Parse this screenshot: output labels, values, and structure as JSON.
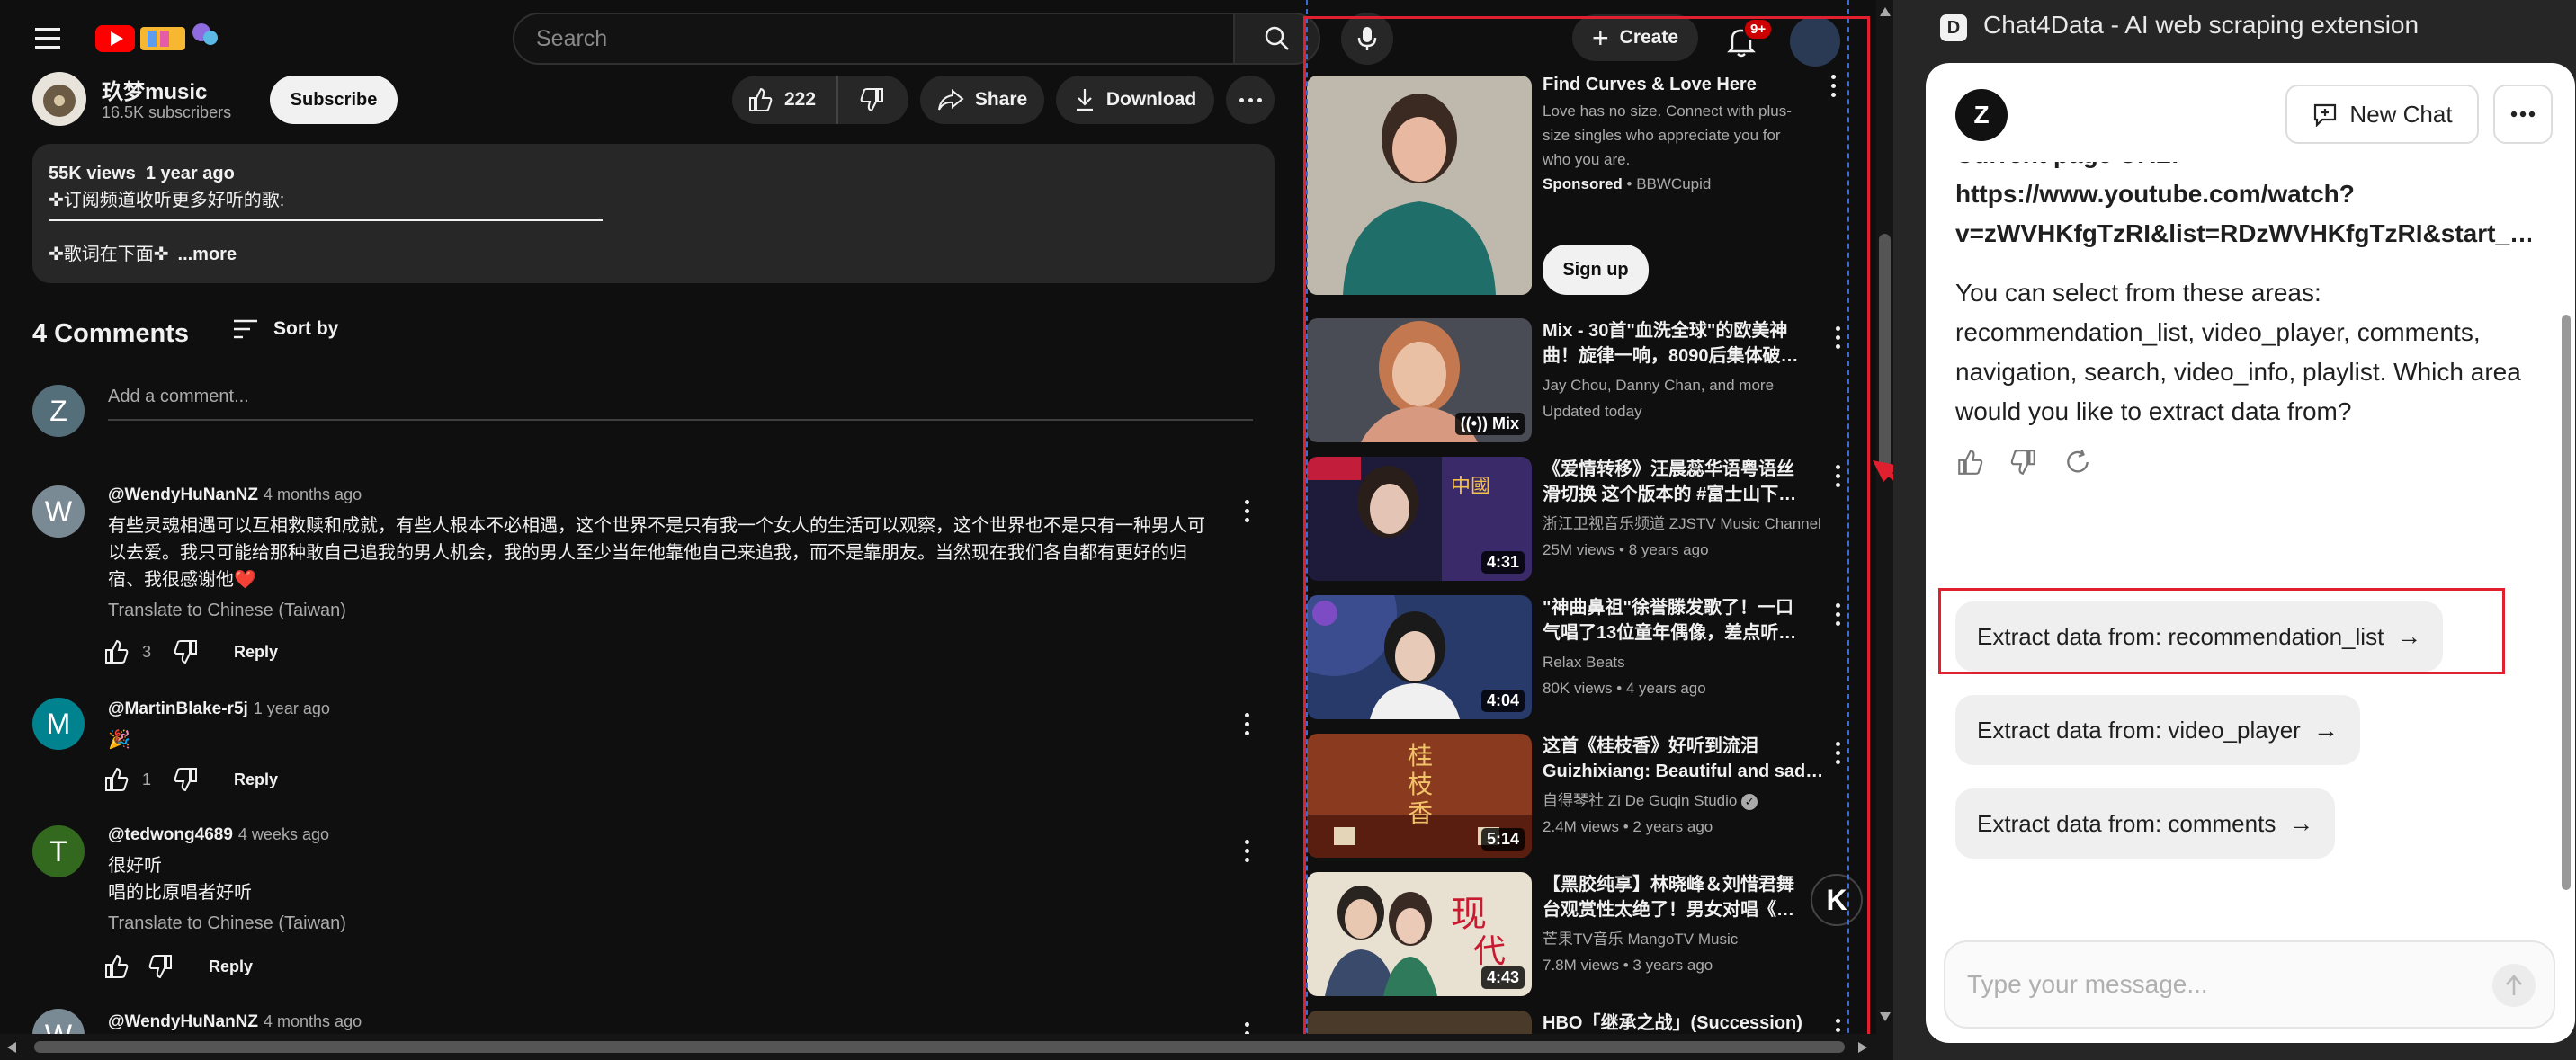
{
  "masthead": {
    "search_placeholder": "Search",
    "create_label": "Create",
    "notif_count": "9+"
  },
  "channel": {
    "name": "玖梦music",
    "subscribers": "16.5K subscribers",
    "subscribe_label": "Subscribe"
  },
  "actions": {
    "like_count": "222",
    "share_label": "Share",
    "download_label": "Download"
  },
  "description": {
    "stats": "55K views  1 year ago",
    "line1": "✜订阅频道收听更多好听的歌:",
    "line2": "✜歌词在下面✜",
    "more": "...more"
  },
  "comments_header": {
    "title": "4 Comments",
    "sort_label": "Sort by",
    "add_placeholder": "Add a comment...",
    "my_avatar": "Z"
  },
  "comments": [
    {
      "avatar": "W",
      "avatar_color": "#7a8a94",
      "author": "@WendyHuNanNZ",
      "time": "4 months ago",
      "text": "有些灵魂相遇可以互相救赎和成就，有些人根本不必相遇，这个世界不是只有我一个女人的生活可以观察，这个世界也不是只有一种男人可以去爱。我只可能给那种敢自己追我的男人机会，我的男人至少当年他靠他自己来追我，而不是靠朋友。当然现在我们各自都有更好的归宿、我很感谢他❤️",
      "translate": "Translate to Chinese (Taiwan)",
      "likes": "3",
      "reply": "Reply"
    },
    {
      "avatar": "M",
      "avatar_color": "#00838f",
      "author": "@MartinBlake-r5j",
      "time": "1 year ago",
      "text": "🎉",
      "likes": "1",
      "reply": "Reply"
    },
    {
      "avatar": "T",
      "avatar_color": "#33691e",
      "author": "@tedwong4689",
      "time": "4 weeks ago",
      "text1": "很好听",
      "text2": "唱的比原唱者好听",
      "translate": "Translate to Chinese (Taiwan)",
      "reply": "Reply"
    },
    {
      "avatar": "W",
      "avatar_color": "#7a8a94",
      "author": "@WendyHuNanNZ",
      "time": "4 months ago"
    }
  ],
  "recommendations": [
    {
      "title1": "Find Curves & Love Here",
      "meta1": "Love has no size. Connect with plus-",
      "meta2": "size singles who appreciate you for",
      "meta3": "who you are.",
      "sponsored": "Sponsored",
      "advertiser": " • BBWCupid",
      "cta": "Sign up"
    },
    {
      "title1": "Mix - 30首\"血洗全球\"的欧美神",
      "title2": "曲！旋律一响，8090后集体破…",
      "meta1": "Jay Chou, Danny Chan, and more",
      "meta2": "Updated today",
      "badge": "Mix"
    },
    {
      "title1": "《爱情转移》汪晨蕊华语粤语丝",
      "title2": "滑切换 这个版本的 #富士山下…",
      "meta1": "浙江卫视音乐频道 ZJSTV Music Channel",
      "meta2": "25M views • 8 years ago",
      "duration": "4:31"
    },
    {
      "title1": "\"神曲鼻祖\"徐誉滕发歌了！一口",
      "title2": "气唱了13位童年偶像，差点听…",
      "meta1": "Relax Beats",
      "meta2": "80K views • 4 years ago",
      "duration": "4:04"
    },
    {
      "title1": "这首《桂枝香》好听到流泪",
      "title2": "Guizhixiang: Beautiful and sad…",
      "meta1": "自得琴社 Zi De Guqin Studio",
      "meta2": "2.4M views • 2 years ago",
      "duration": "5:14"
    },
    {
      "title1": "【黑胶纯享】林晓峰＆刘惜君舞",
      "title2": "台观赏性太绝了！男女对唱《…",
      "meta1": "芒果TV音乐 MangoTV Music",
      "meta2": "7.8M views • 3 years ago",
      "duration": "4:43"
    },
    {
      "title1": "HBO「继承之战」(Succession)"
    }
  ],
  "chat": {
    "title": "Chat4Data - AI web scraping extension",
    "avatar": "Z",
    "new_chat": "New Chat",
    "url_label": "Current page URL:",
    "url1": "https://www.youtube.com/watch?",
    "url2": "v=zWVHKfgTzRI&list=RDzWVHKfgTzRI&start_…",
    "msg1": "You can select from these areas:",
    "msg2": "recommendation_list, video_player, comments,",
    "msg3": "navigation, search, video_info, playlist. Which area",
    "msg4": "would you like to extract data from?",
    "suggestions": [
      "Extract data from: recommendation_list",
      "Extract data from: video_player",
      "Extract data from: comments"
    ],
    "input_placeholder": "Type your message...",
    "accent": "#e0202e"
  }
}
